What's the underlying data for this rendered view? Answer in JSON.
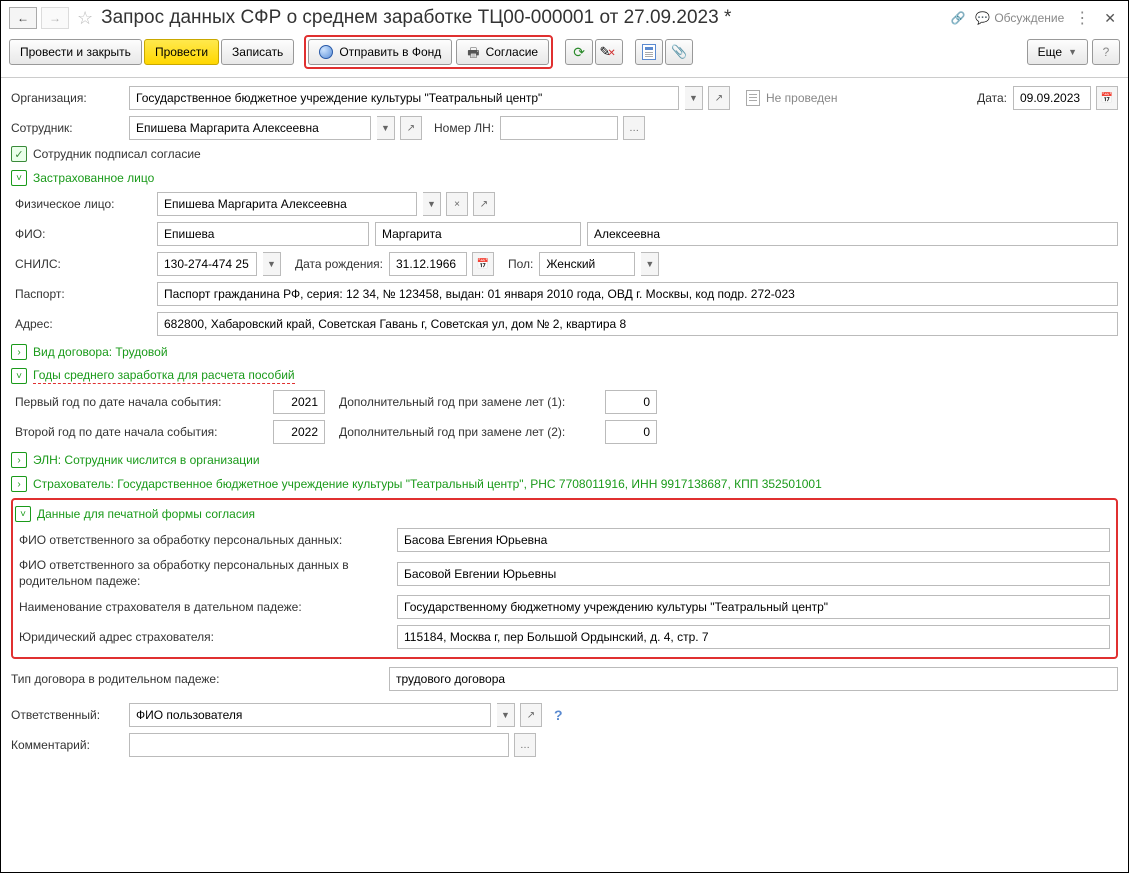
{
  "header": {
    "title": "Запрос данных СФР о среднем заработке ТЦ00-000001 от 27.09.2023 *",
    "discuss": "Обсуждение"
  },
  "toolbar": {
    "post_and_close": "Провести и закрыть",
    "post": "Провести",
    "write": "Записать",
    "send_to_fund": "Отправить в Фонд",
    "consent": "Согласие",
    "more": "Еще"
  },
  "fields": {
    "organization_label": "Организация:",
    "organization_value": "Государственное бюджетное учреждение культуры \"Театральный центр\"",
    "status": "Не проведен",
    "date_label": "Дата:",
    "date_value": "09.09.2023",
    "employee_label": "Сотрудник:",
    "employee_value": "Епишева Маргарита Алексеевна",
    "ln_label": "Номер ЛН:",
    "consent_signed": "Сотрудник подписал согласие"
  },
  "insured": {
    "title": "Застрахованное лицо",
    "physface_label": "Физическое лицо:",
    "physface_value": "Епишева Маргарита Алексеевна",
    "fio_label": "ФИО:",
    "lastname": "Епишева",
    "firstname": "Маргарита",
    "patronymic": "Алексеевна",
    "snils_label": "СНИЛС:",
    "snils_value": "130-274-474 25",
    "birth_label": "Дата рождения:",
    "birth_value": "31.12.1966",
    "gender_label": "Пол:",
    "gender_value": "Женский",
    "passport_label": "Паспорт:",
    "passport_value": "Паспорт гражданина РФ, серия: 12 34, № 123458, выдан: 01 января 2010 года, ОВД г. Москвы, код подр. 272-023",
    "address_label": "Адрес:",
    "address_value": "682800, Хабаровский край, Советская Гавань г, Советская ул, дом № 2, квартира 8"
  },
  "contract": {
    "title": "Вид договора: Трудовой"
  },
  "years": {
    "title": "Годы среднего заработка для расчета пособий",
    "year1_label": "Первый год по дате начала события:",
    "year1_value": "2021",
    "extra1_label": "Дополнительный год при замене лет (1):",
    "extra1_value": "0",
    "year2_label": "Второй год по дате начала события:",
    "year2_value": "2022",
    "extra2_label": "Дополнительный год при замене лет (2):",
    "extra2_value": "0"
  },
  "eln": {
    "title": "ЭЛН: Сотрудник числится в организации"
  },
  "insurer": {
    "title": "Страхователь: Государственное бюджетное учреждение культуры \"Театральный центр\", РНС 7708011916, ИНН 9917138687, КПП 352501001"
  },
  "consent_data": {
    "title": "Данные для печатной формы согласия",
    "resp_label": "ФИО ответственного за обработку персональных данных:",
    "resp_value": "Басова Евгения Юрьевна",
    "resp_gen_label": "ФИО ответственного за обработку персональных данных в родительном падеже:",
    "resp_gen_value": "Басовой Евгении Юрьевны",
    "insurer_dat_label": "Наименование страхователя в дательном падеже:",
    "insurer_dat_value": "Государственному бюджетному учреждению культуры \"Театральный центр\"",
    "legal_addr_label": "Юридический адрес страхователя:",
    "legal_addr_value": "115184, Москва г, пер Большой Ордынский, д. 4, стр. 7"
  },
  "bottom": {
    "contract_type_label": "Тип договора в родительном падеже:",
    "contract_type_value": "трудового договора",
    "responsible_label": "Ответственный:",
    "responsible_value": "ФИО пользователя",
    "comment_label": "Комментарий:"
  }
}
